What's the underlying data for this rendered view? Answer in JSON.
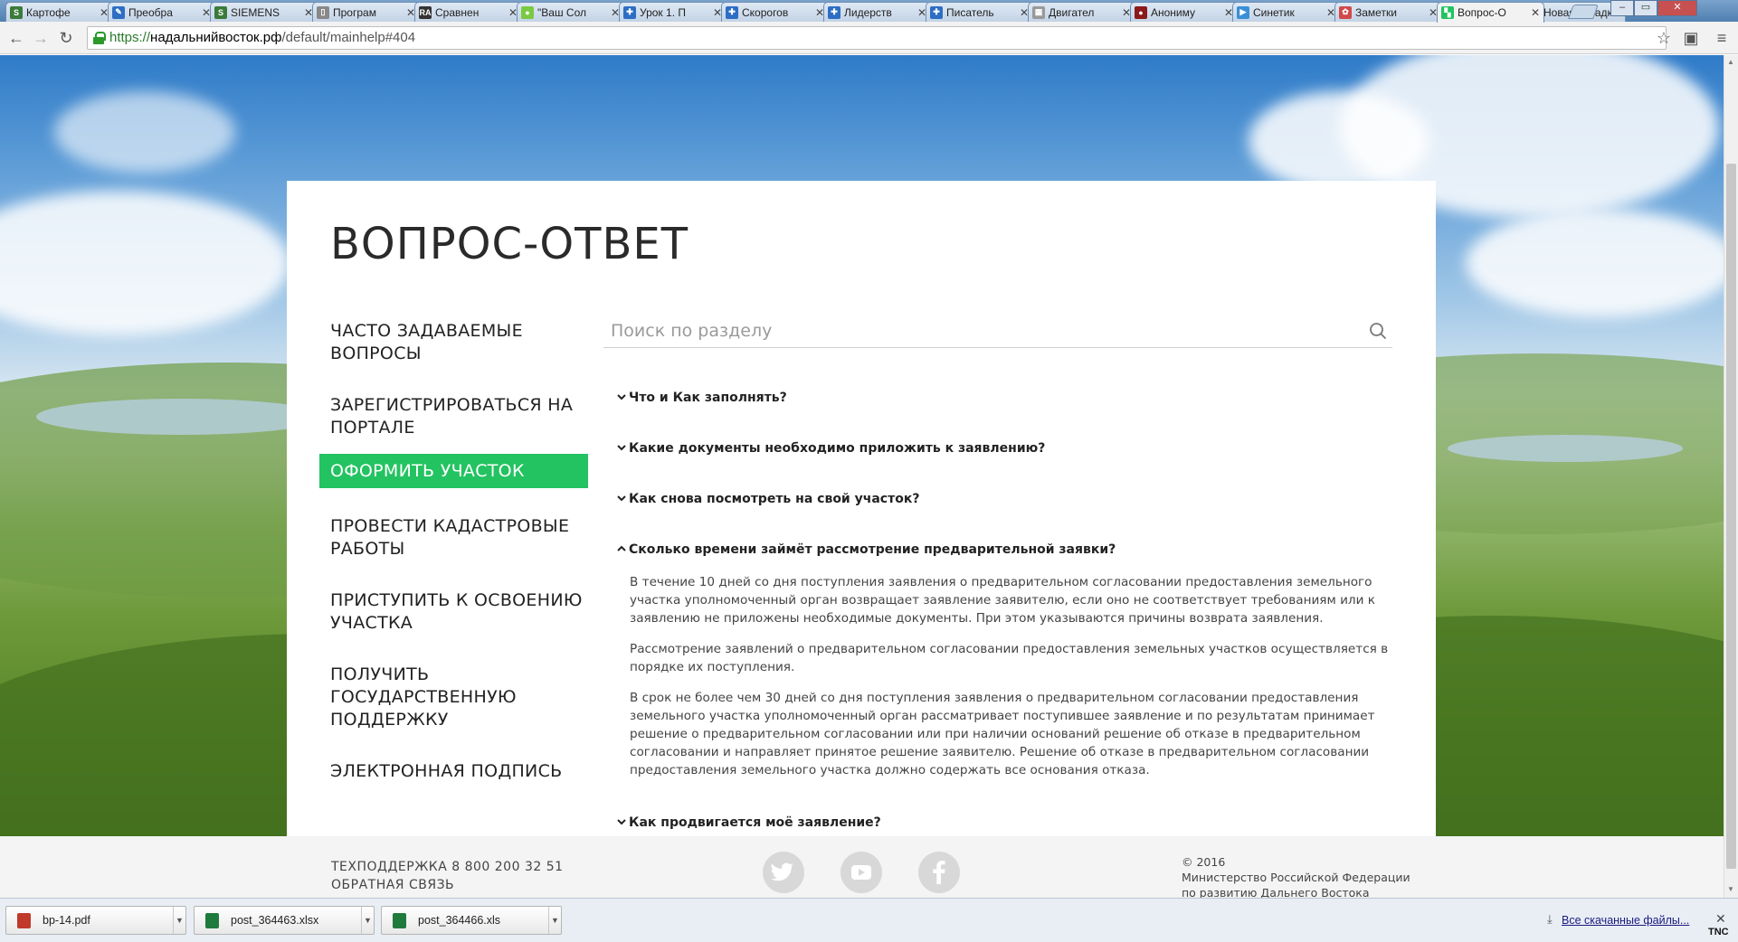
{
  "browser": {
    "tabs": [
      {
        "title": "Картофе",
        "fav_color": "#3a7a3a",
        "fav_glyph": "S"
      },
      {
        "title": "Преобра",
        "fav_color": "#2d6ec4",
        "fav_glyph": "✎"
      },
      {
        "title": "SIEMENS",
        "fav_color": "#3a7a3a",
        "fav_glyph": "S"
      },
      {
        "title": "Програм",
        "fav_color": "#888888",
        "fav_glyph": "▯"
      },
      {
        "title": "Сравнен",
        "fav_color": "#333333",
        "fav_glyph": "RA"
      },
      {
        "title": "\"Ваш Сол",
        "fav_color": "#7ac943",
        "fav_glyph": "●"
      },
      {
        "title": "Урок 1. П",
        "fav_color": "#2d6ec4",
        "fav_glyph": "✚"
      },
      {
        "title": "Скорогов",
        "fav_color": "#2d6ec4",
        "fav_glyph": "✚"
      },
      {
        "title": "Лидерств",
        "fav_color": "#2d6ec4",
        "fav_glyph": "✚"
      },
      {
        "title": "Писатель",
        "fav_color": "#2d6ec4",
        "fav_glyph": "✚"
      },
      {
        "title": "Двигател",
        "fav_color": "#999999",
        "fav_glyph": "▦"
      },
      {
        "title": "Анониму",
        "fav_color": "#8b1a1a",
        "fav_glyph": "●"
      },
      {
        "title": "Синетик",
        "fav_color": "#3a8fd6",
        "fav_glyph": "▶"
      },
      {
        "title": "Заметки",
        "fav_color": "#d04a4a",
        "fav_glyph": "✿"
      },
      {
        "title": "Вопрос-О",
        "fav_color": "#23c361",
        "fav_glyph": "▚",
        "active": true
      },
      {
        "title": "Новая вкладк",
        "fav_color": "",
        "fav_glyph": ""
      }
    ],
    "url_scheme": "https://",
    "url_host": "надальнийвосток.рф",
    "url_path": "/default/mainhelp#404"
  },
  "page": {
    "title": "ВОПРОС-ОТВЕТ",
    "nav": [
      {
        "label": "ЧАСТО ЗАДАВАЕМЫЕ ВОПРОСЫ"
      },
      {
        "label": "ЗАРЕГИСТРИРОВАТЬСЯ НА ПОРТАЛЕ"
      },
      {
        "label": "ОФОРМИТЬ УЧАСТОК",
        "active": true
      },
      {
        "label": "ПРОВЕСТИ КАДАСТРОВЫЕ РАБОТЫ"
      },
      {
        "label": "ПРИСТУПИТЬ К ОСВОЕНИЮ УЧАСТКА"
      },
      {
        "label": "ПОЛУЧИТЬ ГОСУДАРСТВЕННУЮ ПОДДЕРЖКУ"
      },
      {
        "label": "ЭЛЕКТРОННАЯ ПОДПИСЬ"
      }
    ],
    "search_placeholder": "Поиск по разделу",
    "accent_color": "#23c361",
    "faq": [
      {
        "q": "Что и Как заполнять?",
        "expanded": false
      },
      {
        "q": "Какие документы необходимо приложить к заявлению?",
        "expanded": false
      },
      {
        "q": "Как снова посмотреть на свой участок?",
        "expanded": false
      },
      {
        "q": "Сколько времени займёт рассмотрение предварительной заявки?",
        "expanded": true,
        "answer": [
          "В течение 10 дней со дня поступления заявления о предварительном согласовании предоставления земельного участка уполномоченный орган возвращает заявление заявителю, если оно не соответствует требованиям или к заявлению не приложены необходимые документы. При этом указываются причины возврата заявления.",
          "Рассмотрение заявлений о предварительном согласовании предоставления земельных участков осуществляется в порядке их поступления.",
          "В срок не более чем 30 дней со дня поступления заявления о предварительном согласовании предоставления земельного участка уполномоченный орган рассматривает поступившее заявление и по результатам принимает решение о предварительном согласовании или при наличии оснований решение об отказе в предварительном согласовании и направляет принятое решение заявителю. Решение об отказе в предварительном согласовании предоставления земельного участка должно содержать все основания отказа."
        ]
      },
      {
        "q": "Как продвигается моё заявление?",
        "expanded": false
      }
    ]
  },
  "footer": {
    "support": "ТЕХПОДДЕРЖКА 8 800 200 32 51",
    "feedback": "ОБРАТНАЯ СВЯЗЬ",
    "social": [
      "twitter-icon",
      "youtube-icon",
      "facebook-icon"
    ],
    "copyright_year": "© 2016",
    "copyright_line1": "Министерство Российской Федерации",
    "copyright_line2": "по развитию Дальнего Востока"
  },
  "downloads": {
    "items": [
      {
        "name": "bp-14.pdf",
        "icon": "pdf-icon",
        "color": "#c0392b"
      },
      {
        "name": "post_364463.xlsx",
        "icon": "excel-icon",
        "color": "#1f7a3e"
      },
      {
        "name": "post_364466.xls",
        "icon": "excel-icon",
        "color": "#1f7a3e"
      }
    ],
    "all_label": "Все скачанные файлы...",
    "tray_label": "TNC"
  }
}
